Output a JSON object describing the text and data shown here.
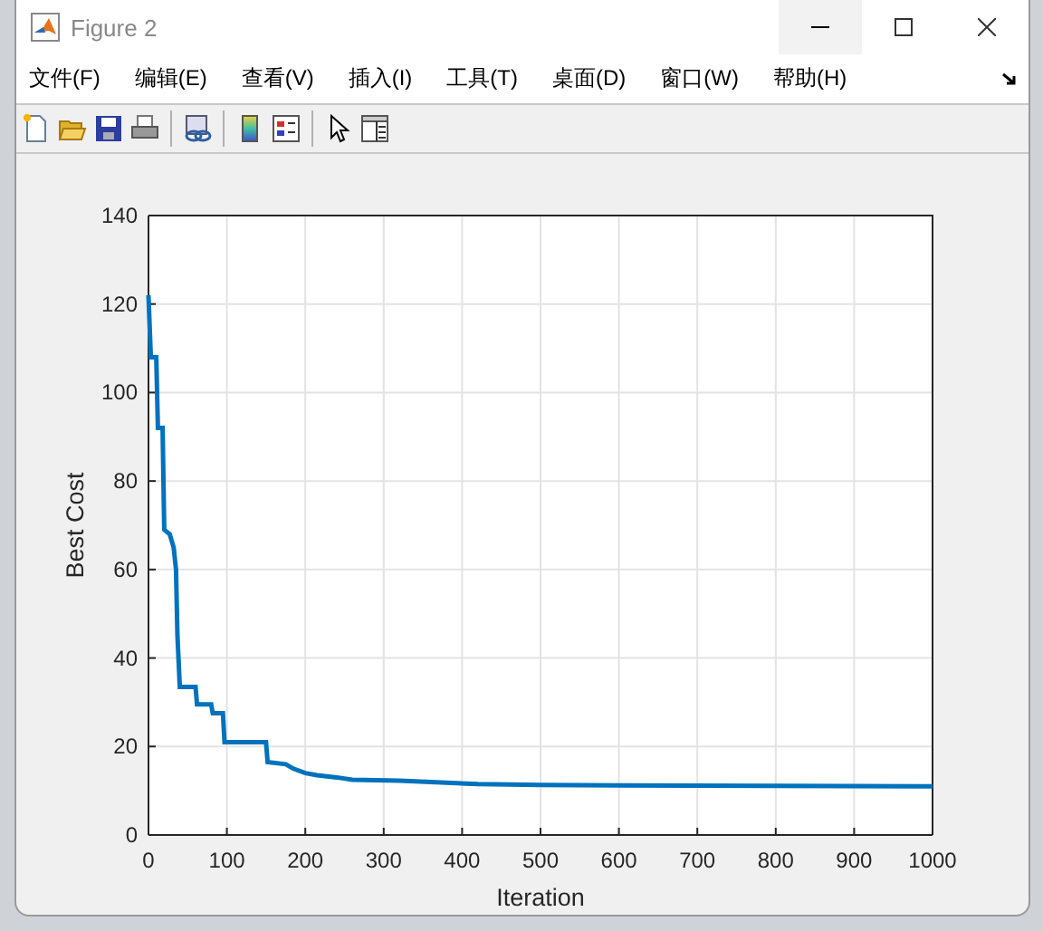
{
  "window": {
    "title": "Figure 2"
  },
  "menu": [
    "文件(F)",
    "编辑(E)",
    "查看(V)",
    "插入(I)",
    "工具(T)",
    "桌面(D)",
    "窗口(W)",
    "帮助(H)"
  ],
  "toolbar": [
    {
      "kind": "new"
    },
    {
      "kind": "open"
    },
    {
      "kind": "save"
    },
    {
      "kind": "print"
    },
    {
      "kind": "separator"
    },
    {
      "kind": "link"
    },
    {
      "kind": "separator"
    },
    {
      "kind": "colorbar"
    },
    {
      "kind": "legend"
    },
    {
      "kind": "separator"
    },
    {
      "kind": "pointer"
    },
    {
      "kind": "inspector"
    }
  ],
  "chart_data": {
    "type": "line",
    "grid": true,
    "xlabel": "Iteration",
    "ylabel": "Best Cost",
    "xlim": [
      0,
      1000
    ],
    "ylim": [
      0,
      140
    ],
    "xticks": [
      0,
      100,
      200,
      300,
      400,
      500,
      600,
      700,
      800,
      900,
      1000
    ],
    "yticks": [
      0,
      20,
      40,
      60,
      80,
      100,
      120,
      140
    ],
    "x": [
      0,
      3,
      10,
      12,
      18,
      20,
      27,
      32,
      35,
      37,
      40,
      60,
      62,
      80,
      82,
      95,
      97,
      150,
      152,
      175,
      185,
      200,
      215,
      240,
      260,
      320,
      360,
      420,
      500,
      600,
      800,
      1000
    ],
    "series": [
      {
        "color": "#0072bd",
        "values": [
          122,
          108,
          108,
          92,
          92,
          69,
          68,
          65,
          60,
          45,
          33.5,
          33.5,
          29.5,
          29.5,
          27.5,
          27.5,
          21,
          21,
          16.5,
          16,
          15,
          14,
          13.5,
          13,
          12.5,
          12.3,
          12,
          11.5,
          11.3,
          11.2,
          11.1,
          11
        ]
      }
    ]
  }
}
